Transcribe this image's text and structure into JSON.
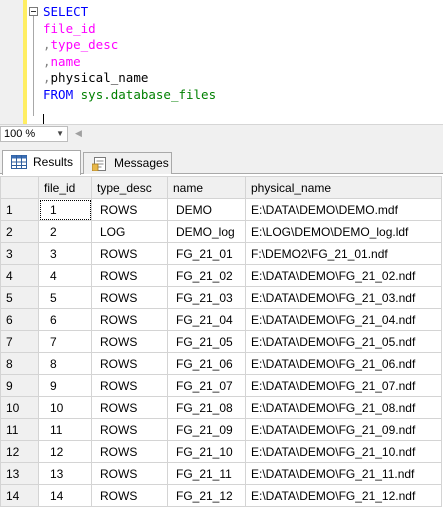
{
  "editor": {
    "lines": [
      {
        "parts": [
          {
            "t": "SELECT",
            "c": "kw"
          }
        ]
      },
      {
        "parts": [
          {
            "t": "file_id",
            "c": "field"
          }
        ]
      },
      {
        "parts": [
          {
            "t": ",",
            "c": "punct"
          },
          {
            "t": "type_desc",
            "c": "field"
          }
        ]
      },
      {
        "parts": [
          {
            "t": ",",
            "c": "punct"
          },
          {
            "t": "name",
            "c": "field"
          }
        ]
      },
      {
        "parts": [
          {
            "t": ",",
            "c": "punct"
          },
          {
            "t": "physical_name",
            "c": "plain"
          }
        ]
      },
      {
        "parts": [
          {
            "t": "FROM ",
            "c": "kw"
          },
          {
            "t": "sys.database_files",
            "c": "tbl"
          }
        ]
      }
    ]
  },
  "zoom": {
    "value": "100 %"
  },
  "tabs": {
    "results": "Results",
    "messages": "Messages"
  },
  "results": {
    "columns": [
      "file_id",
      "type_desc",
      "name",
      "physical_name"
    ],
    "rows": [
      [
        "1",
        "1",
        "ROWS",
        "DEMO",
        "E:\\DATA\\DEMO\\DEMO.mdf"
      ],
      [
        "2",
        "2",
        "LOG",
        "DEMO_log",
        "E:\\LOG\\DEMO\\DEMO_log.ldf"
      ],
      [
        "3",
        "3",
        "ROWS",
        "FG_21_01",
        "F:\\DEMO2\\FG_21_01.ndf"
      ],
      [
        "4",
        "4",
        "ROWS",
        "FG_21_02",
        "E:\\DATA\\DEMO\\FG_21_02.ndf"
      ],
      [
        "5",
        "5",
        "ROWS",
        "FG_21_03",
        "E:\\DATA\\DEMO\\FG_21_03.ndf"
      ],
      [
        "6",
        "6",
        "ROWS",
        "FG_21_04",
        "E:\\DATA\\DEMO\\FG_21_04.ndf"
      ],
      [
        "7",
        "7",
        "ROWS",
        "FG_21_05",
        "E:\\DATA\\DEMO\\FG_21_05.ndf"
      ],
      [
        "8",
        "8",
        "ROWS",
        "FG_21_06",
        "E:\\DATA\\DEMO\\FG_21_06.ndf"
      ],
      [
        "9",
        "9",
        "ROWS",
        "FG_21_07",
        "E:\\DATA\\DEMO\\FG_21_07.ndf"
      ],
      [
        "10",
        "10",
        "ROWS",
        "FG_21_08",
        "E:\\DATA\\DEMO\\FG_21_08.ndf"
      ],
      [
        "11",
        "11",
        "ROWS",
        "FG_21_09",
        "E:\\DATA\\DEMO\\FG_21_09.ndf"
      ],
      [
        "12",
        "12",
        "ROWS",
        "FG_21_10",
        "E:\\DATA\\DEMO\\FG_21_10.ndf"
      ],
      [
        "13",
        "13",
        "ROWS",
        "FG_21_11",
        "E:\\DATA\\DEMO\\FG_21_11.ndf"
      ],
      [
        "14",
        "14",
        "ROWS",
        "FG_21_12",
        "E:\\DATA\\DEMO\\FG_21_12.ndf"
      ]
    ]
  },
  "icons": {
    "results": "grid-icon",
    "messages": "messages-icon",
    "fold": "collapse-icon"
  },
  "colors": {
    "keyword": "#0000ff",
    "field": "#ff00ff",
    "table": "#008000",
    "margin": "#ffee62"
  }
}
